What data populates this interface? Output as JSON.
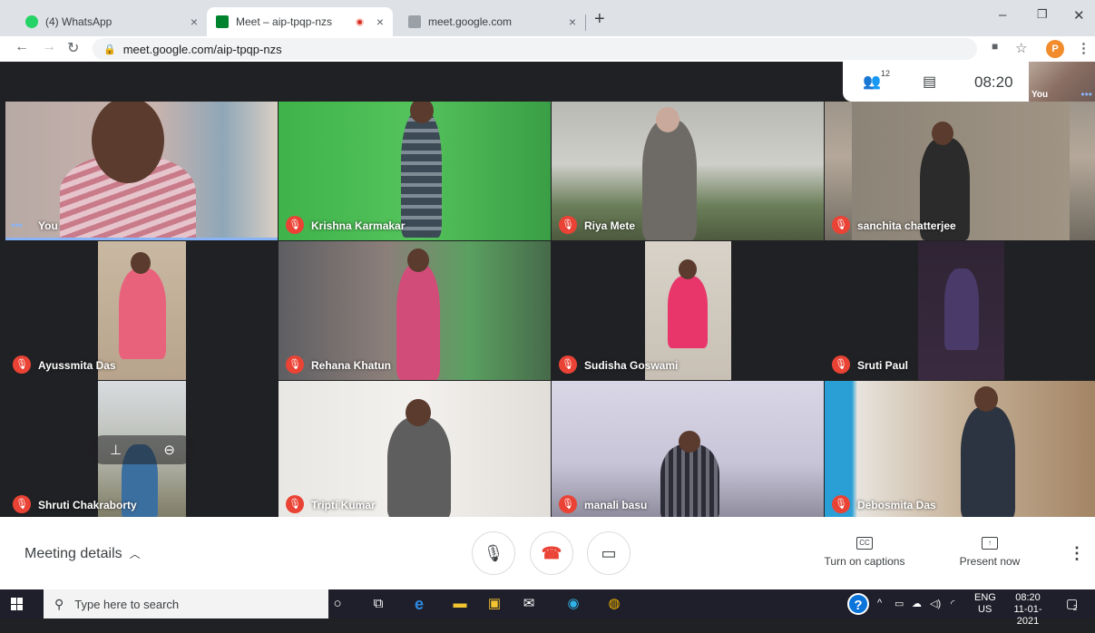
{
  "browser": {
    "tabs": [
      {
        "label": "(4) WhatsApp"
      },
      {
        "label": "Meet – aip-tpqp-nzs"
      },
      {
        "label": "meet.google.com"
      }
    ],
    "url": "meet.google.com/aip-tpqp-nzs",
    "profile_initial": "P"
  },
  "meet": {
    "participant_count": "12",
    "time": "08:20",
    "self_label": "You",
    "tiles": [
      {
        "name": "You"
      },
      {
        "name": "Krishna Karmakar"
      },
      {
        "name": "Riya Mete"
      },
      {
        "name": "sanchita chatterjee"
      },
      {
        "name": "Ayussmita Das"
      },
      {
        "name": "Rehana Khatun"
      },
      {
        "name": "Sudisha Goswami"
      },
      {
        "name": "Sruti Paul"
      },
      {
        "name": "Shruti Chakraborty"
      },
      {
        "name": "Tripti Kumar"
      },
      {
        "name": "manali basu"
      },
      {
        "name": "Debosmita Das"
      }
    ],
    "controls": {
      "meeting_details": "Meeting details",
      "captions": "Turn on captions",
      "present": "Present now"
    }
  },
  "taskbar": {
    "search_placeholder": "Type here to search",
    "lang_top": "ENG",
    "lang_bottom": "US",
    "clock_time": "08:20",
    "clock_date": "11-01-2021",
    "notif_count": "2"
  }
}
